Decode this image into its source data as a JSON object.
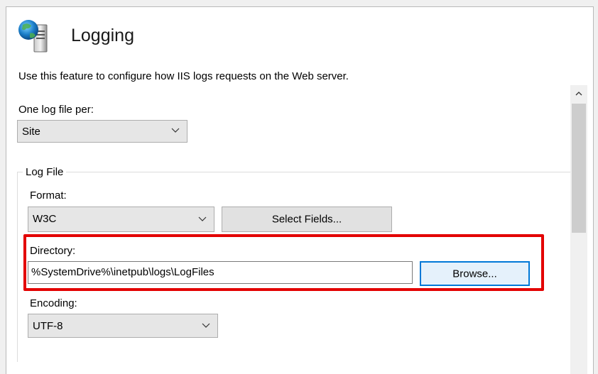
{
  "header": {
    "title": "Logging",
    "icon": "globe-server-icon"
  },
  "description": "Use this feature to configure how IIS logs requests on the Web server.",
  "one_log_file_per": {
    "label": "One log file per:",
    "value": "Site"
  },
  "log_file": {
    "group_label": "Log File",
    "format": {
      "label": "Format:",
      "value": "W3C",
      "select_fields_label": "Select Fields..."
    },
    "directory": {
      "label": "Directory:",
      "value": "%SystemDrive%\\inetpub\\logs\\LogFiles",
      "browse_label": "Browse..."
    },
    "encoding": {
      "label": "Encoding:",
      "value": "UTF-8"
    }
  },
  "colors": {
    "highlight": "#e30000",
    "focus_border": "#0078d7"
  }
}
